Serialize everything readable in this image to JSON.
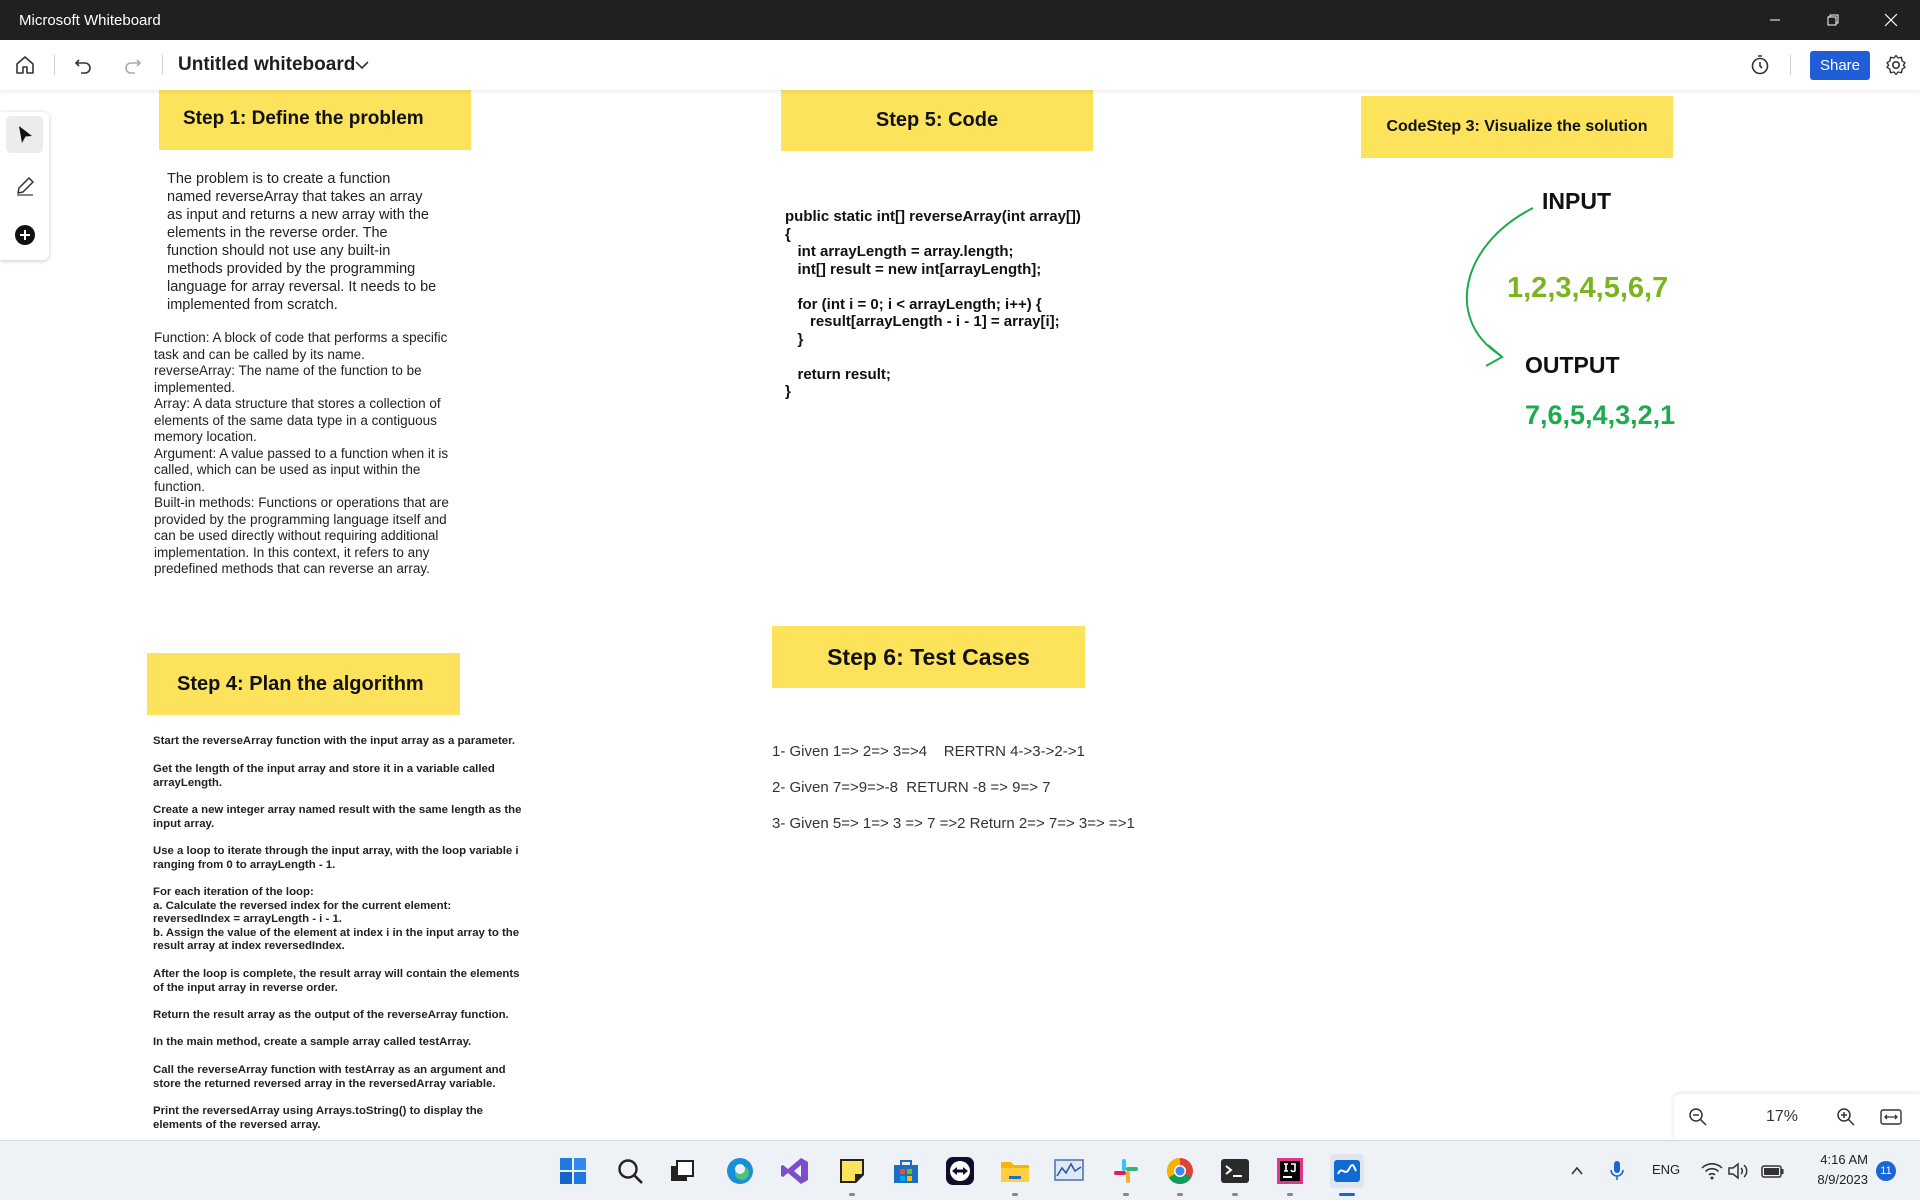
{
  "window": {
    "title": "Microsoft Whiteboard"
  },
  "toolbar": {
    "board_title": "Untitled whiteboard",
    "share_label": "Share"
  },
  "notes": {
    "step1": "Step 1: Define the problem",
    "step5": "Step 5: Code",
    "step3": "CodeStep 3: Visualize the solution",
    "step4": "Step 4: Plan the algorithm",
    "step6": "Step 6: Test Cases"
  },
  "problem": {
    "paragraph": "The problem is to create a function\nnamed reverseArray that takes an array\nas input and returns a new array with the\nelements in the reverse order. The\nfunction should not use any built-in\nmethods provided by the programming\nlanguage for array reversal. It needs to be\nimplemented from scratch.",
    "glossary": "Function: A block of code that performs a specific\ntask and can be called by its name.\nreverseArray: The name of the function to be\nimplemented.\nArray: A data structure that stores a collection of\nelements of the same data type in a contiguous\nmemory location.\nArgument: A value passed to a function when it is\ncalled, which can be used as input within the\nfunction.\nBuilt-in methods: Functions or operations that are\nprovided by the programming language itself and\ncan be used directly without requiring additional\nimplementation. In this context, it refers to any\npredefined methods that can reverse an array."
  },
  "code": {
    "text": "public static int[] reverseArray(int array[])\n{\n   int arrayLength = array.length;\n   int[] result = new int[arrayLength];\n\n   for (int i = 0; i < arrayLength; i++) {\n      result[arrayLength - i - 1] = array[i];\n   }\n\n   return result;\n}"
  },
  "visualize": {
    "input_label": "INPUT",
    "input_value": "1,2,3,4,5,6,7",
    "output_label": "OUTPUT",
    "output_value": "7,6,5,4,3,2,1",
    "input_color": "#7ab51d",
    "output_color": "#1faa4e"
  },
  "algorithm": {
    "steps": [
      "Start the reverseArray function with the input array as a parameter.",
      "Get the length of the input array and store it in a variable called\narrayLength.",
      "Create a new integer array named result with the same length as the\ninput array.",
      "Use a loop to iterate through the input array, with the loop variable i\nranging from 0 to arrayLength - 1.",
      "For each iteration of the loop:\na. Calculate the reversed index for the current element:\nreversedIndex = arrayLength - i - 1.\nb. Assign the value of the element at index i in the input array to the\nresult array at index reversedIndex.",
      "After the loop is complete, the result array will contain the elements\nof the input array in reverse order.",
      "Return the result array as the output of the reverseArray function.",
      "In the main method, create a sample array called testArray.",
      "Call the reverseArray function with testArray as an argument and\nstore the returned reversed array in the reversedArray variable.",
      "Print the reversedArray using Arrays.toString() to display the\nelements of the reversed array."
    ]
  },
  "tests": [
    "1- Given 1=> 2=> 3=>4    RERTRN 4->3->2->1",
    "2- Given 7=>9=>-8  RETURN -8 => 9=> 7",
    "3- Given 5=> 1=> 3 => 7 =>2 Return 2=> 7=> 3=> =>1"
  ],
  "zoom": {
    "level": "17%"
  },
  "taskbar": {
    "language": "ENG",
    "time": "4:16 AM",
    "date": "8/9/2023",
    "notification_count": "11",
    "apps": [
      "start-icon",
      "search-icon",
      "task-view-icon",
      "edge-icon",
      "visual-studio-icon",
      "sticky-notes-icon",
      "store-icon",
      "teamviewer-icon",
      "file-explorer-icon",
      "performance-monitor-icon",
      "slack-icon",
      "chrome-icon",
      "terminal-icon",
      "intellij-icon",
      "whiteboard-icon"
    ]
  }
}
